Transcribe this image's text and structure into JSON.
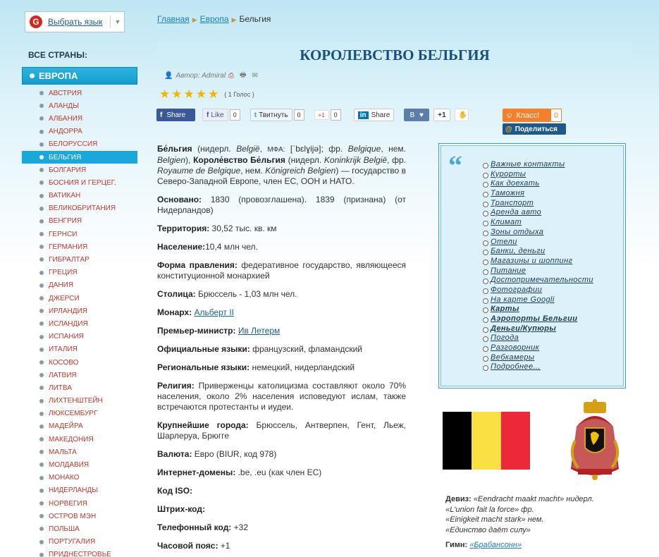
{
  "lang": {
    "label": "Выбрать язык",
    "icon": "google-translate-icon"
  },
  "sidebar": {
    "heading": "ВСЕ СТРАНЫ:",
    "region": "ЕВРОПА",
    "items": [
      "АВСТРИЯ",
      "АЛАНДЫ",
      "АЛБАНИЯ",
      "АНДОРРА",
      "БЕЛОРУССИЯ",
      "БЕЛЬГИЯ",
      "БОЛГАРИЯ",
      "БОСНИЯ И ГЕРЦЕГ.",
      "ВАТИКАН",
      "ВЕЛИКОБРИТАНИЯ",
      "ВЕНГРИЯ",
      "ГЕРНСИ",
      "ГЕРМАНИЯ",
      "ГИБРАЛТАР",
      "ГРЕЦИЯ",
      "ДАНИЯ",
      "ДЖЕРСИ",
      "ИРЛАНДИЯ",
      "ИСЛАНДИЯ",
      "ИСПАНИЯ",
      "ИТАЛИЯ",
      "КОСОВО",
      "ЛАТВИЯ",
      "ЛИТВА",
      "ЛИХТЕНШТЕЙН",
      "ЛЮКСЕМБУРГ",
      "МАДЕЙРА",
      "МАКЕДОНИЯ",
      "МАЛЬТА",
      "МОЛДАВИЯ",
      "МОНАКО",
      "НИДЕРЛАНДЫ",
      "НОРВЕГИЯ",
      "ОСТРОВ МЭН",
      "ПОЛЬША",
      "ПОРТУГАЛИЯ",
      "ПРИДНЕСТРОВЬЕ"
    ],
    "active_index": 5
  },
  "breadcrumb": {
    "home": "Главная",
    "region": "Европа",
    "current": "Бельгия"
  },
  "title": "КОРОЛЕВСТВО БЕЛЬГИЯ",
  "meta": {
    "author_label": "Автор:",
    "author": "Admiral"
  },
  "rating": {
    "stars": 5,
    "votes": "( 1 Голос )"
  },
  "share": {
    "fb": "Share",
    "fb_like": "Like",
    "fb_like_count": "0",
    "tweet": "Твитнуть",
    "tweet_count": "0",
    "gplus": "+1",
    "gplus_count": "0",
    "linkedin": "Share",
    "vk": "B",
    "vk_heart": "♥",
    "plusone": "+1",
    "ok": "Класс!",
    "ok_count": "0",
    "mail_share": "Поделиться"
  },
  "info": {
    "intro_name1": "Бе́льгия",
    "intro_p1": " (нидерл. ",
    "intro_i1": "België",
    "intro_p2": ", ",
    "intro_sm1": "МФА:",
    "intro_p3": " [ˈbɛlɣijə]; фр. ",
    "intro_i2": "Belgique",
    "intro_p4": ", нем. ",
    "intro_i3": "Belgien",
    "intro_p5": "), ",
    "intro_name2": "Короле́вство Бе́льгия",
    "intro_p6": " (нидерл. ",
    "intro_i4": "Koninkrijk België",
    "intro_p7": ", фр. ",
    "intro_i5": "Royaume de Belgique",
    "intro_p8": ", нем. ",
    "intro_i6": "Königreich Belgien",
    "intro_p9": ") — государство в Северо-Западной Европе, член ЕС, ООН и НАТО.",
    "founded_l": "Основано:",
    "founded_v": " 1830 (провозглашена). 1839 (признана) (от Нидерландов)",
    "terr_l": "Территория:",
    "terr_v": " 30,52 тыс. кв. км",
    "pop_l": "Население:",
    "pop_v": "10,4 млн чел.",
    "gov_l": "Форма правления:",
    "gov_v": " федеративное государство, являющееся конституционной монархией",
    "cap_l": "Столица:",
    "cap_v": " Брюссель - 1,03 млн чел.",
    "mon_l": "Монарх:",
    "mon_v": "Альберт II",
    "pm_l": "Премьер-министр:",
    "pm_v": "Ив Летерм",
    "off_l": "Официальные языки:",
    "off_v": " французский, фламандский",
    "reg_l": "Региональные языки:",
    "reg_v": " немецкий, нидерландский",
    "rel_l": "Религия:",
    "rel_v": " Приверженцы католицизма составляют около 70% населения, около 2% населения исповедуют ислам, также встречаются протестанты и иудеи.",
    "city_l": "Крупнейшие города:",
    "city_v": " Брюссель, Антверпен, Гент, Льеж, Шарлеруа, Брюгге",
    "cur_l": "Валюта:",
    "cur_v": " Евро (BIUR, код 978)",
    "dom_l": "Интернет-домены:",
    "dom_v": " .be, .eu (как член ЕС)",
    "iso_l": "Код ISO:",
    "bar_l": "Штрих-код:",
    "tel_l": "Телефонный код:",
    "tel_v": " +32",
    "tz_l": "Часовой пояс:",
    "tz_v": " +1"
  },
  "links": [
    "Важные контакты",
    "Курорты",
    "Как доехать",
    "Таможня",
    "Транспорт",
    "Аренда авто",
    "Климат",
    "Зоны отдыха",
    "Отели",
    "Банки, деньги",
    "Магазины и шоппинг",
    "Питание",
    "Достопримечательности",
    "Фотографии",
    "На карте Googli",
    "Карты",
    "Аэропорты Бельгии",
    "Деньги/Купюры",
    "Погода",
    "Разговорник",
    "Вебкамеры",
    "Подробнее..."
  ],
  "bold_links": [
    15,
    16,
    17
  ],
  "flag_colors": [
    "#000000",
    "#fae042",
    "#ed2939"
  ],
  "motto": {
    "label": "Девиз:",
    "l1": "«Eendracht maakt macht» нидерл.",
    "l2": "«L'union fait la force» фр.",
    "l3": "«Einigkeit macht stark» нем.",
    "l4": "«Единство даёт силу»"
  },
  "hymn": {
    "label": "Гимн:",
    "value": "«Брабансонн»"
  }
}
